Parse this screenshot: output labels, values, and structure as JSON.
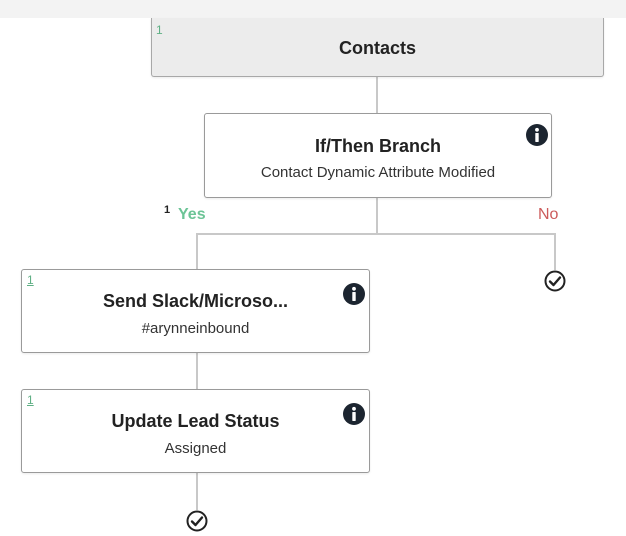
{
  "contacts": {
    "count": "1",
    "title": "Contacts"
  },
  "branch": {
    "title": "If/Then Branch",
    "subtitle": "Contact Dynamic Attribute Modified",
    "yes_count": "1",
    "yes_label": "Yes",
    "no_label": "No"
  },
  "slack": {
    "count": "1",
    "title": "Send Slack/Microso...",
    "subtitle": "#arynneinbound"
  },
  "lead": {
    "count": "1",
    "title": "Update Lead Status",
    "subtitle": "Assigned"
  },
  "icons": {
    "info": "info-circle-icon",
    "end": "check-circle-icon"
  },
  "colors": {
    "yes": "#6cc496",
    "no": "#cc5b5b",
    "count": "#5fb085",
    "info": "#1c2530"
  }
}
